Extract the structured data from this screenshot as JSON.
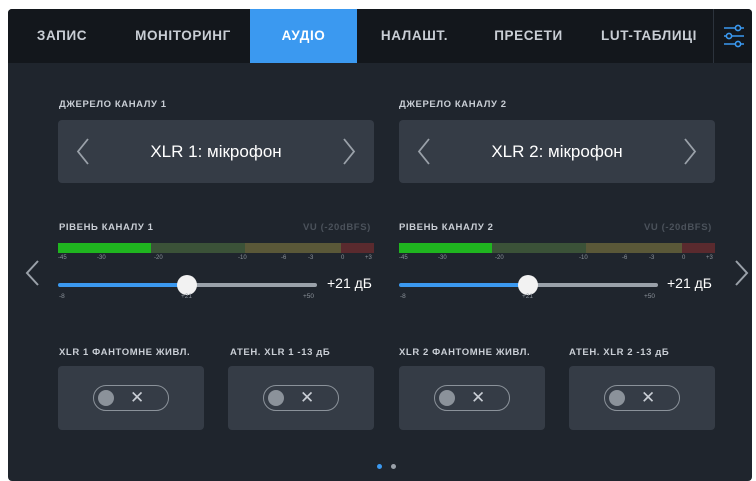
{
  "tabs": [
    "ЗАПИС",
    "МОНІТОРИНГ",
    "АУДІО",
    "НАЛАШТ.",
    "ПРЕСЕТИ",
    "LUT-ТАБЛИЦІ"
  ],
  "active_tab": "АУДІО",
  "menu_icon": "sliders-icon",
  "channels": [
    {
      "source_label": "ДЖЕРЕЛО КАНАЛУ 1",
      "source_value": "XLR 1: мікрофон",
      "level_label": "РІВЕНЬ КАНАЛУ 1",
      "meter_scale": "VU (-20dBFS)",
      "meter_ticks": [
        "-45",
        "-30",
        "-20",
        "-10",
        "-6",
        "-3",
        "0",
        "+3"
      ],
      "meter_level_db": -20,
      "slider_min": "-8",
      "slider_mid": "+21",
      "slider_max": "+50",
      "slider_fraction": 0.5,
      "level_value": "+21 дБ",
      "phantom_label": "XLR 1 ФАНТОМНЕ ЖИВЛ.",
      "phantom_state": "off",
      "atten_label": "АТЕН. XLR 1 -13 дБ",
      "atten_state": "off"
    },
    {
      "source_label": "ДЖЕРЕЛО КАНАЛУ 2",
      "source_value": "XLR 2: мікрофон",
      "level_label": "РІВЕНЬ КАНАЛУ 2",
      "meter_scale": "VU (-20dBFS)",
      "meter_ticks": [
        "-45",
        "-30",
        "-20",
        "-10",
        "-6",
        "-3",
        "0",
        "+3"
      ],
      "meter_level_db": -20,
      "slider_min": "-8",
      "slider_mid": "+21",
      "slider_max": "+50",
      "slider_fraction": 0.5,
      "level_value": "+21 дБ",
      "phantom_label": "XLR 2 ФАНТОМНЕ ЖИВЛ.",
      "phantom_state": "off",
      "atten_label": "АТЕН. XLR 2 -13 дБ",
      "atten_state": "off"
    }
  ],
  "toggle_off_symbol": "✕",
  "page_indicator": {
    "pages": 2,
    "current": 1
  },
  "colors": {
    "accent": "#3b99f0",
    "background": "#1f252d",
    "topbar": "#13171c",
    "panel": "#353c46",
    "meter_green": "#1fb51f",
    "meter_green_dim": "#3b5238",
    "meter_yellow_dim": "#5a5838",
    "meter_red_dim": "#5a2a2e"
  }
}
